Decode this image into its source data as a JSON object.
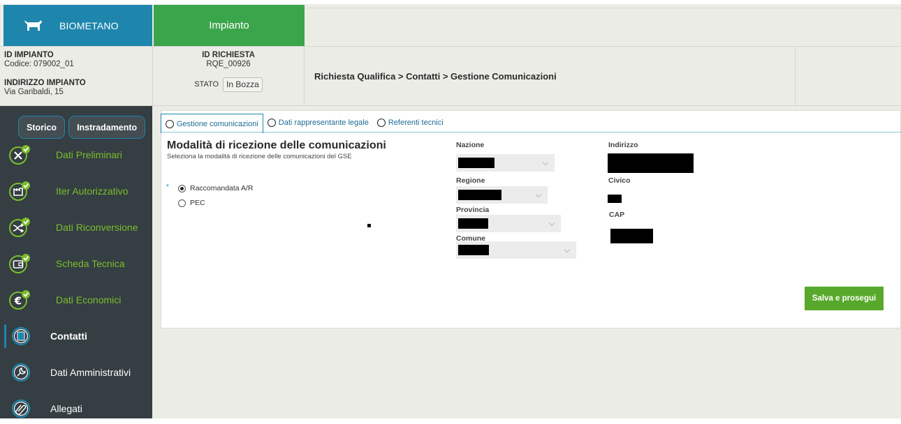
{
  "app": {
    "brand": "BIOMETANO",
    "active_tab": "Impianto"
  },
  "info": {
    "id_impianto_label": "ID IMPIANTO",
    "codice": "Codice: 079002_01",
    "indirizzo_label": "INDIRIZZO IMPIANTO",
    "indirizzo_value": "Via Garibaldi, 15",
    "id_richiesta_label": "ID RICHIESTA",
    "id_richiesta_value": "RQE_00926",
    "stato_label": "STATO",
    "stato_value": "In Bozza",
    "breadcrumb": "Richiesta Qualifica > Contatti > Gestione Comunicazioni"
  },
  "sidebar": {
    "buttons": [
      "Storico",
      "Instradamento"
    ],
    "items": [
      {
        "label": "Dati Preliminari",
        "icon": "tools-icon",
        "done": true
      },
      {
        "label": "Iter Autorizzativo",
        "icon": "factory-icon",
        "done": true
      },
      {
        "label": "Dati Riconversione",
        "icon": "shuffle-icon",
        "done": true
      },
      {
        "label": "Scheda Tecnica",
        "icon": "wallet-icon",
        "done": true
      },
      {
        "label": "Dati Economici",
        "icon": "euro-icon",
        "done": true
      },
      {
        "label": "Contatti",
        "icon": "contacts-icon",
        "active": true
      },
      {
        "label": "Dati Amministrativi",
        "icon": "wrench-icon"
      },
      {
        "label": "Allegati",
        "icon": "paperclip-icon"
      }
    ]
  },
  "tabs": [
    "Gestione comunicazioni",
    "Dati rappresentante legale",
    "Referenti tecnici"
  ],
  "section": {
    "title": "Modalità di ricezione delle comunicazioni",
    "subtitle": "Seleziona la modalità di ricezione delle comunicazioni del GSE",
    "required_mark": "*",
    "options": [
      {
        "label": "Raccomandata A/R",
        "selected": true
      },
      {
        "label": "PEC",
        "selected": false
      }
    ]
  },
  "fields": {
    "nazione": "Nazione",
    "regione": "Regione",
    "provincia": "Provincia",
    "comune": "Comune",
    "indirizzo": "Indirizzo",
    "civico": "Civico",
    "cap": "CAP"
  },
  "actions": {
    "save": "Salva e prosegui"
  },
  "colors": {
    "brand_blue": "#1e86ad",
    "green": "#3ba54b",
    "sidebar": "#353e42",
    "accent_green": "#7bbd2e"
  }
}
